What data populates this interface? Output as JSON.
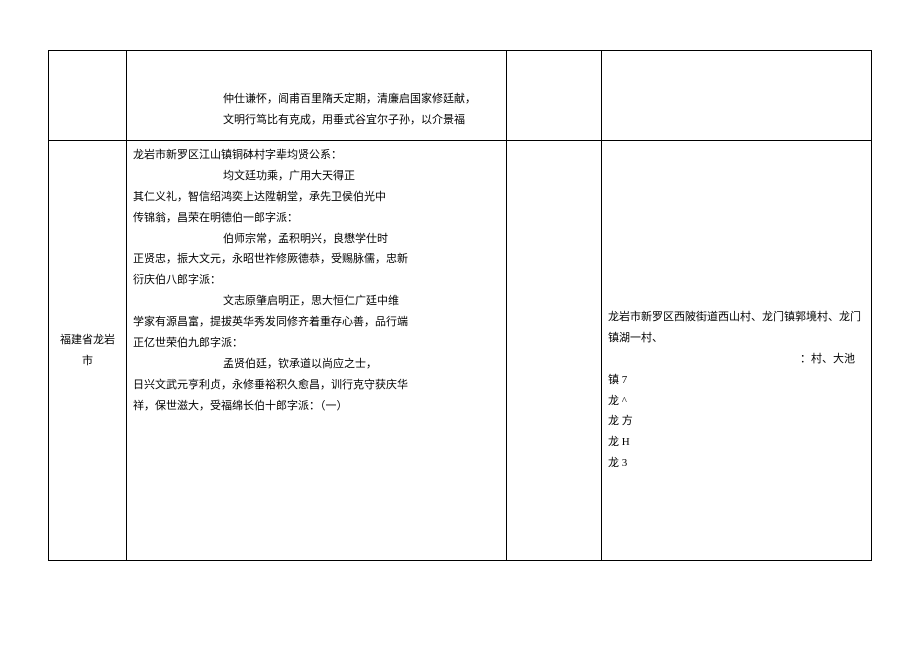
{
  "table": {
    "row1": {
      "c1": "",
      "c2_l1": "仲仕谦怀，闾甫百里隋夭定期，清廉启国家修廷献，",
      "c2_l2": "文明行笃比有克成，用垂式谷宜尔子孙，以介景福",
      "c3": "",
      "c4": ""
    },
    "row2": {
      "c1": "福建省龙岩市",
      "c2_p1": "龙岩市新罗区江山镇铜砵村字辈均贤公系：",
      "c2_p2_indent": "均文廷功乘，广用大天得正",
      "c2_p3": "其仁义礼，智信绍鸿奕上达陞朝堂，承先卫侯伯光中",
      "c2_p4": "传锦翁，昌荣在明德伯一郎字派：",
      "c2_p5_indent": "伯师宗常，孟积明兴，良懋学仕时",
      "c2_p6": "正贤忠，振大文元，永昭世祚修厥德恭，受赐脉儒，忠新",
      "c2_p7": "衍庆伯八郎字派：",
      "c2_p8_indent": "文志原肇启明正，思大恒仁广廷中维",
      "c2_p9": "学家有源昌富，提拔英华秀发同修齐着重存心善，品行端",
      "c2_p10": "正亿世荣伯九郎字派：",
      "c2_p11_indent": "孟贤伯廷，钦承道以尚应之士，",
      "c2_p12": "日兴文武元亨利贞，永修垂裕积久愈昌，训行克守获庆华",
      "c2_p13": "祥，保世滋大，受福绵长伯十郎字派：（一）",
      "c3": "",
      "c4_l1": "龙岩市新罗区西陂街道西山村、龙门镇郭境村、龙门镇湖一村、",
      "c4_l2": "：村、大池",
      "c4_l3": "镇 7",
      "c4_l4": "龙 ^",
      "c4_l5": "龙 方",
      "c4_l6": "龙 H",
      "c4_l7": "龙 3"
    }
  }
}
